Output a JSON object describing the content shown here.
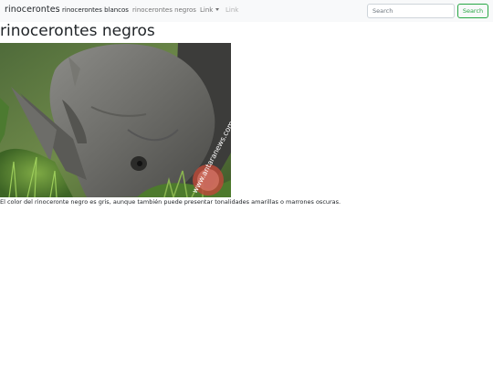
{
  "navbar": {
    "brand": "rinocerontes",
    "items": [
      {
        "label": "rinocerontes blancos",
        "state": "active"
      },
      {
        "label": "rinocerontes negros",
        "state": "default"
      },
      {
        "label": "Link",
        "state": "dropdown"
      },
      {
        "label": "Link",
        "state": "disabled"
      }
    ],
    "search": {
      "placeholder": "Search",
      "value": "",
      "button_label": "Search"
    }
  },
  "main": {
    "title": "rinocerontes negros",
    "image": {
      "watermark": "www.antaranews.com"
    },
    "caption": "El color del rinoceronte negro es gris, aunque también puede presentar tonalidades amarillas o marrones oscuras."
  },
  "colors": {
    "navbar_bg": "#f8f9fa",
    "success": "#28a745",
    "text": "#212529",
    "muted_link": "rgba(0,0,0,0.55)"
  }
}
